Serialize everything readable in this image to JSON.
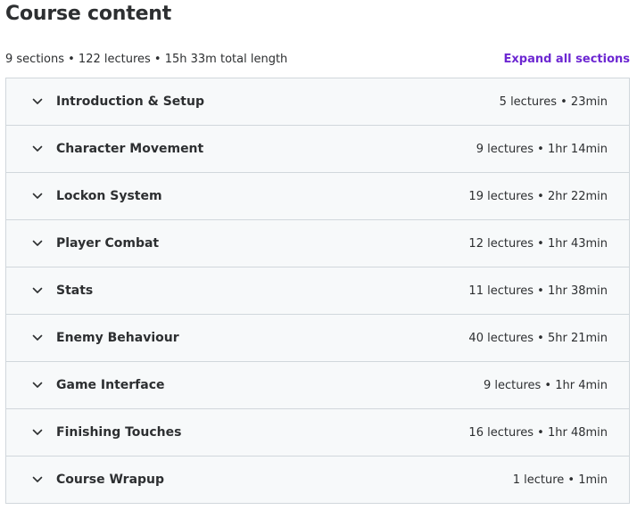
{
  "header": {
    "title": "Course content",
    "summary": "9 sections • 122 lectures • 15h 33m total length",
    "expand_label": "Expand all sections"
  },
  "colors": {
    "accent": "#6d28d2",
    "row_background": "#f7f9fa",
    "border": "#d1d7dc",
    "text": "#2d2f31"
  },
  "sections": [
    {
      "title": "Introduction & Setup",
      "meta": "5 lectures • 23min",
      "icon": "chevron-down-icon"
    },
    {
      "title": "Character Movement",
      "meta": "9 lectures • 1hr 14min",
      "icon": "chevron-down-icon"
    },
    {
      "title": "Lockon System",
      "meta": "19 lectures • 2hr 22min",
      "icon": "chevron-down-icon"
    },
    {
      "title": "Player Combat",
      "meta": "12 lectures • 1hr 43min",
      "icon": "chevron-down-icon"
    },
    {
      "title": "Stats",
      "meta": "11 lectures • 1hr 38min",
      "icon": "chevron-down-icon"
    },
    {
      "title": "Enemy Behaviour",
      "meta": "40 lectures • 5hr 21min",
      "icon": "chevron-down-icon"
    },
    {
      "title": "Game Interface",
      "meta": "9 lectures • 1hr 4min",
      "icon": "chevron-down-icon"
    },
    {
      "title": "Finishing Touches",
      "meta": "16 lectures • 1hr 48min",
      "icon": "chevron-down-icon"
    },
    {
      "title": "Course Wrapup",
      "meta": "1 lecture • 1min",
      "icon": "chevron-down-icon"
    }
  ]
}
